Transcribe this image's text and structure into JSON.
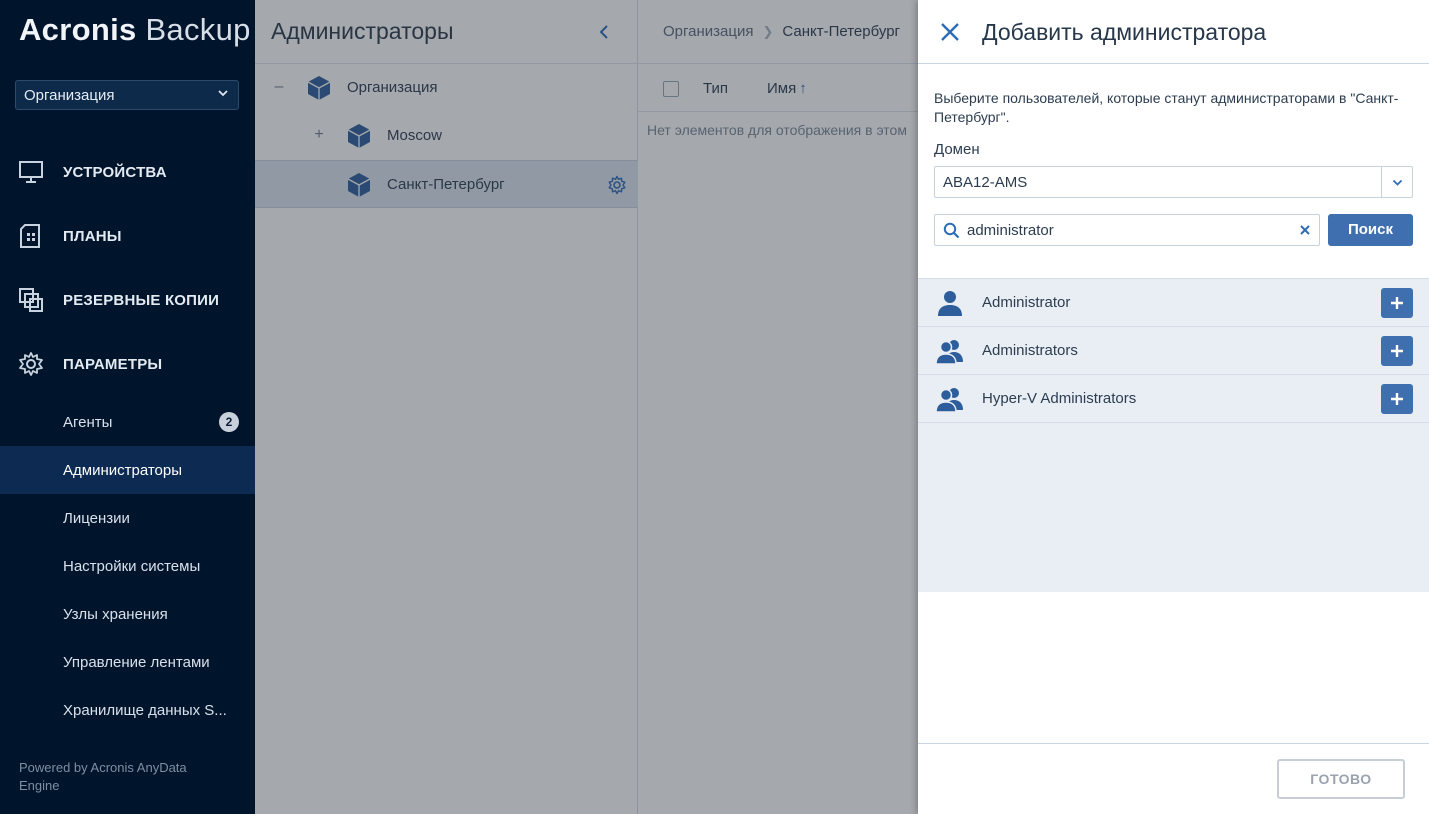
{
  "app": {
    "logo_brand": "Acronis",
    "logo_product": "Backup",
    "org_select": "Организация",
    "powered_by": "Powered by Acronis AnyData Engine"
  },
  "sidebar": {
    "main_items": [
      {
        "label": "УСТРОЙСТВА",
        "icon": "monitor-icon"
      },
      {
        "label": "ПЛАНЫ",
        "icon": "plans-icon"
      },
      {
        "label": "РЕЗЕРВНЫЕ КОПИИ",
        "icon": "backups-icon"
      },
      {
        "label": "ПАРАМЕТРЫ",
        "icon": "gear-icon"
      }
    ],
    "sub_items": [
      {
        "label": "Агенты",
        "badge": "2"
      },
      {
        "label": "Администраторы",
        "active": true
      },
      {
        "label": "Лицензии"
      },
      {
        "label": "Настройки системы"
      },
      {
        "label": "Узлы хранения"
      },
      {
        "label": "Управление лентами"
      },
      {
        "label": "Хранилище данных S..."
      }
    ]
  },
  "tree": {
    "title": "Администраторы",
    "nodes": [
      {
        "label": "Организация",
        "toggle": "–"
      },
      {
        "label": "Moscow",
        "toggle": "+"
      },
      {
        "label": "Санкт-Петербург",
        "toggle": "",
        "selected": true
      }
    ]
  },
  "list": {
    "breadcrumb": [
      "Организация",
      "Санкт-Петербург"
    ],
    "columns": {
      "type": "Тип",
      "name": "Имя",
      "sort_arrow": "↑"
    },
    "empty_message": "Нет элементов для отображения в этом"
  },
  "drawer": {
    "title": "Добавить администратора",
    "description": "Выберите пользователей, которые станут администраторами в \"Санкт-Петербург\".",
    "domain_label": "Домен",
    "domain_value": "ABA12-AMS",
    "search_value": "administrator",
    "search_button": "Поиск",
    "results": [
      {
        "name": "Administrator",
        "icon": "user-icon"
      },
      {
        "name": "Administrators",
        "icon": "group-icon"
      },
      {
        "name": "Hyper-V Administrators",
        "icon": "group-icon"
      }
    ],
    "done_button": "ГОТОВО"
  },
  "colors": {
    "sidebar_bg": "#00142b",
    "accent": "#3f6fae",
    "selected_row": "#dce6f1"
  }
}
